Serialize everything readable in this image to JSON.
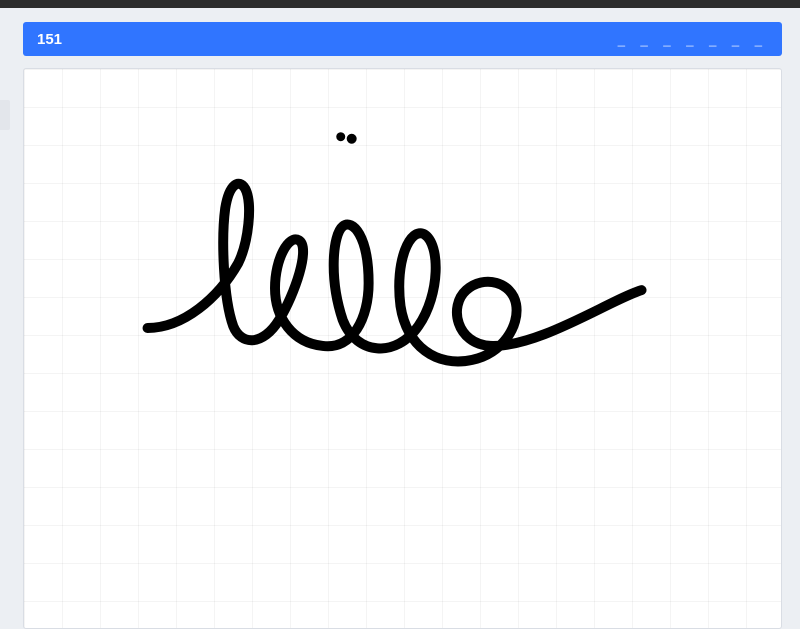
{
  "header": {
    "timer": "151",
    "word_blanks": "_ _ _ _ _ _ _"
  },
  "drawing": {
    "label": "hello",
    "word_length": 7
  },
  "colors": {
    "header_bg": "#3075ff",
    "page_bg": "#eceff3",
    "canvas_bg": "#ffffff",
    "stroke": "#000000"
  }
}
